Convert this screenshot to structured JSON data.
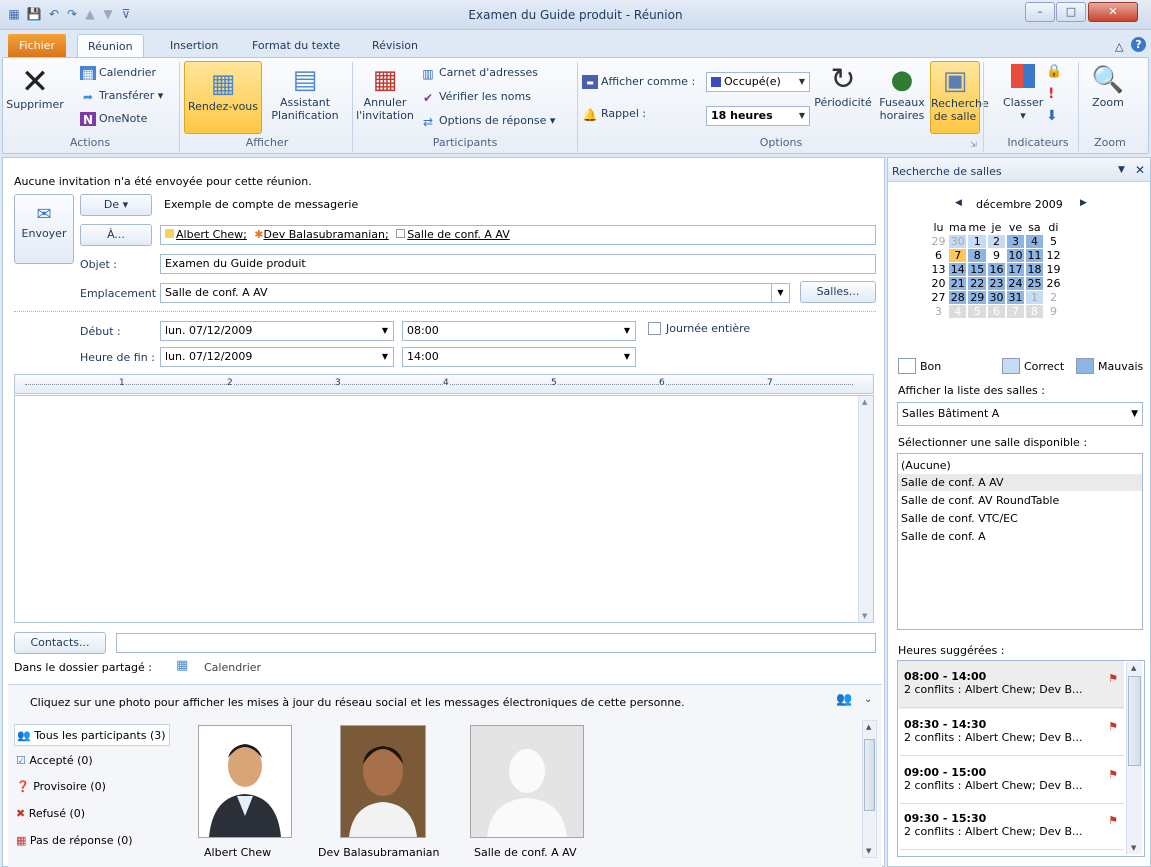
{
  "window": {
    "title": "Examen du Guide produit - Réunion"
  },
  "tabs": [
    "Fichier",
    "Réunion",
    "Insertion",
    "Format du texte",
    "Révision"
  ],
  "ribbon": {
    "actions": {
      "delete": "Supprimer",
      "calendar": "Calendrier",
      "forward": "Transférer",
      "onenote": "OneNote",
      "label": "Actions"
    },
    "afficher": {
      "rendezvous": "Rendez-vous",
      "assistant1": "Assistant",
      "assistant2": "Planification",
      "label": "Afficher"
    },
    "participants": {
      "cancel1": "Annuler",
      "cancel2": "l'invitation",
      "addressbook": "Carnet d'adresses",
      "checknames": "Vérifier les noms",
      "responseopts": "Options de réponse",
      "label": "Participants"
    },
    "options": {
      "showas_label": "Afficher comme :",
      "showas_value": "Occupé(e)",
      "reminder_label": "Rappel :",
      "reminder_value": "18 heures",
      "recurrence": "Périodicité",
      "tz1": "Fuseaux",
      "tz2": "horaires",
      "room1": "Recherche",
      "room2": "de salle",
      "label": "Options"
    },
    "indicateurs": {
      "classify": "Classer",
      "label": "Indicateurs"
    },
    "zoom": {
      "zoom": "Zoom",
      "label": "Zoom"
    }
  },
  "form": {
    "info": "Aucune invitation n'a été envoyée pour cette réunion.",
    "send": "Envoyer",
    "from_btn": "De",
    "from_value": "Exemple de compte de messagerie",
    "to_btn": "À...",
    "to_recipients": [
      "Albert Chew;",
      "Dev Balasubramanian;",
      "Salle de conf. A AV"
    ],
    "subject_label": "Objet :",
    "subject_value": "Examen du Guide produit",
    "location_label": "Emplacement :",
    "location_value": "Salle de conf. A AV",
    "rooms_btn": "Salles...",
    "start_label": "Début :",
    "start_date": "lun. 07/12/2009",
    "start_time": "08:00",
    "allday": "Journée entière",
    "end_label": "Heure de fin :",
    "end_date": "lun. 07/12/2009",
    "end_time": "14:00",
    "ruler": [
      "1",
      "2",
      "3",
      "4",
      "5",
      "6",
      "7"
    ],
    "contacts_btn": "Contacts...",
    "shared_folder_label": "Dans le dossier partagé :",
    "shared_folder_value": "Calendrier"
  },
  "social": {
    "info": "Cliquez sur une photo pour afficher les mises à jour du réseau social et les messages électroniques de cette personne.",
    "filters": [
      "Tous les participants (3)",
      "Accepté (0)",
      "Provisoire (0)",
      "Refusé (0)",
      "Pas de réponse (0)"
    ],
    "people": [
      "Albert Chew",
      "Dev Balasubramanian",
      "Salle de conf. A AV"
    ]
  },
  "roomfinder": {
    "title": "Recherche de salles",
    "month": "décembre 2009",
    "days": [
      "lu",
      "ma",
      "me",
      "je",
      "ve",
      "sa",
      "di"
    ],
    "weeks": [
      [
        "29",
        "30",
        "1",
        "2",
        "3",
        "4",
        "5"
      ],
      [
        "6",
        "7",
        "8",
        "9",
        "10",
        "11",
        "12"
      ],
      [
        "13",
        "14",
        "15",
        "16",
        "17",
        "18",
        "19"
      ],
      [
        "20",
        "21",
        "22",
        "23",
        "24",
        "25",
        "26"
      ],
      [
        "27",
        "28",
        "29",
        "30",
        "31",
        "1",
        "2"
      ],
      [
        "3",
        "4",
        "5",
        "6",
        "7",
        "8",
        "9"
      ]
    ],
    "legend": [
      "Bon",
      "Correct",
      "Mauvais"
    ],
    "list_label": "Afficher la liste des salles :",
    "list_value": "Salles Bâtiment A",
    "select_label": "Sélectionner une salle disponible :",
    "rooms": [
      "(Aucune)",
      "Salle de conf. A AV",
      "Salle de conf. AV RoundTable",
      "Salle de conf. VTC/EC",
      "Salle de conf. A"
    ],
    "suggested_label": "Heures suggérées :",
    "suggestions": [
      {
        "time": "08:00 - 14:00",
        "detail": "2 conflits :  Albert Chew; Dev B..."
      },
      {
        "time": "08:30 - 14:30",
        "detail": "2 conflits :  Albert Chew; Dev B..."
      },
      {
        "time": "09:00 - 15:00",
        "detail": "2 conflits :  Albert Chew; Dev B..."
      },
      {
        "time": "09:30 - 15:30",
        "detail": "2 conflits :  Albert Chew; Dev B..."
      }
    ]
  }
}
